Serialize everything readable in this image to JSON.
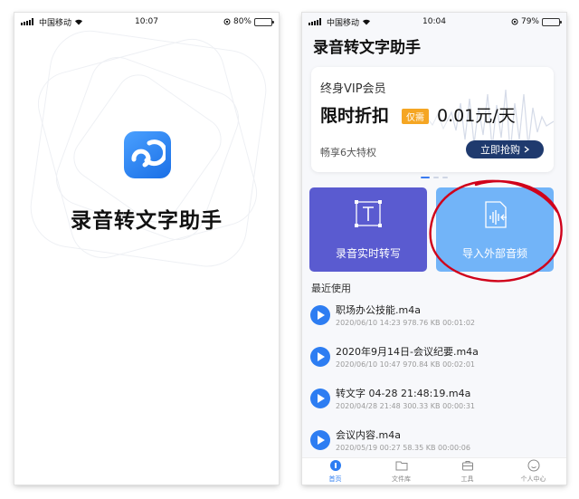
{
  "left_screen": {
    "status": {
      "carrier": "中国移动",
      "time": "10:07",
      "battery": "80%",
      "battery_level": 0.8
    },
    "app_title": "录音转文字助手",
    "logo_icon": "app-logo-icon"
  },
  "right_screen": {
    "status": {
      "carrier": "中国移动",
      "time": "10:04",
      "battery": "79%",
      "battery_level": 0.79
    },
    "header_title": "录音转文字助手",
    "banner": {
      "vip_title": "终身VIP会员",
      "promo": "限时折扣",
      "only_badge": "仅需",
      "price": "0.01元/天",
      "perks": "畅享6大特权",
      "buy_button": "立即抢购"
    },
    "carousel": {
      "active_index": 0,
      "count": 3
    },
    "actions": {
      "record": {
        "label": "录音实时转写",
        "icon": "text-transcribe-icon"
      },
      "import": {
        "label": "导入外部音频",
        "icon": "audio-import-icon"
      }
    },
    "recent_label": "最近使用",
    "files": [
      {
        "name": "职场办公技能.m4a",
        "meta": "2020/06/10 14:23 978.76 KB 00:01:02"
      },
      {
        "name": "2020年9月14日-会议纪要.m4a",
        "meta": "2020/06/10 10:47 970.84 KB 00:02:01"
      },
      {
        "name": "转文字 04-28 21:48:19.m4a",
        "meta": "2020/04/28 21:48 300.33 KB 00:00:31"
      },
      {
        "name": "会议内容.m4a",
        "meta": "2020/05/19 00:27 58.35 KB 00:00:06"
      }
    ],
    "tabs": [
      {
        "label": "首页",
        "icon": "home-icon",
        "active": true
      },
      {
        "label": "文件库",
        "icon": "folder-icon",
        "active": false
      },
      {
        "label": "工具",
        "icon": "toolbox-icon",
        "active": false
      },
      {
        "label": "个人中心",
        "icon": "profile-icon",
        "active": false
      }
    ]
  },
  "colors": {
    "accent": "#2d7df2",
    "record_card": "#5a5bd0",
    "import_card": "#72b4f8",
    "badge": "#f5a623",
    "buy_button": "#1f3a6e",
    "annotation": "#d0021b"
  }
}
